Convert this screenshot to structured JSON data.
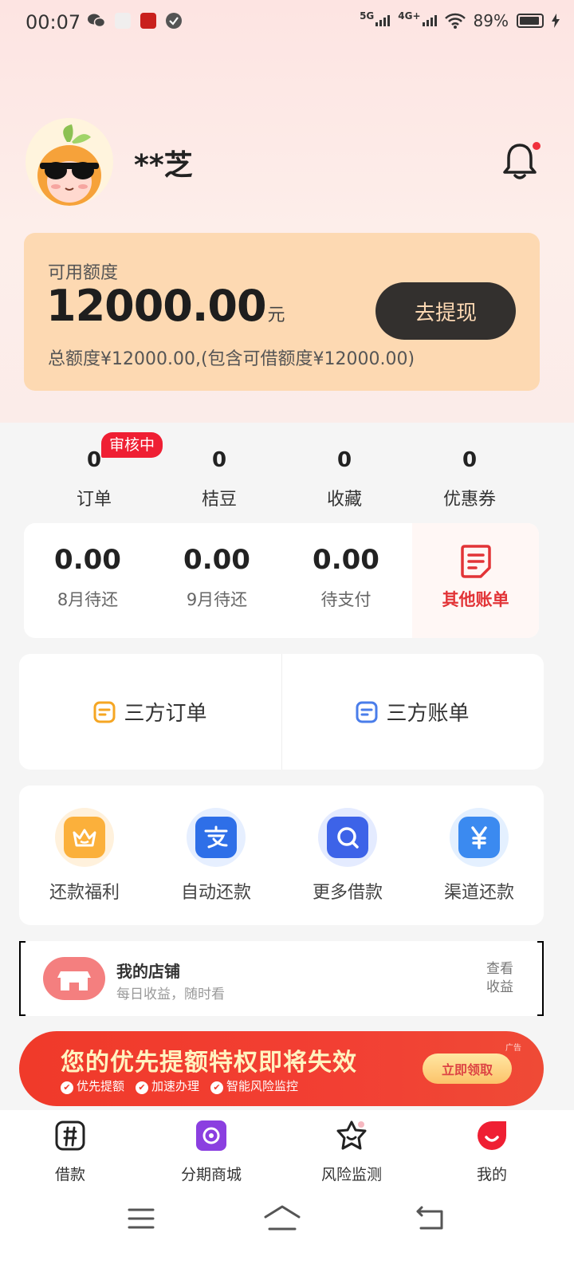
{
  "status": {
    "time": "00:07",
    "net1": "5G",
    "net2": "4G+",
    "battery": "89%"
  },
  "profile": {
    "username": "**芝"
  },
  "credit": {
    "label": "可用额度",
    "amount": "12000.00",
    "unit": "元",
    "total": "总额度¥12000.00,(包含可借额度¥12000.00)",
    "button": "去提现"
  },
  "stats": [
    {
      "value": "0",
      "label": "订单"
    },
    {
      "value": "0",
      "label": "桔豆"
    },
    {
      "value": "0",
      "label": "收藏"
    },
    {
      "value": "0",
      "label": "优惠券"
    }
  ],
  "stats_badge": "审核中",
  "bills": [
    {
      "value": "0.00",
      "label": "8月待还"
    },
    {
      "value": "0.00",
      "label": "9月待还"
    },
    {
      "value": "0.00",
      "label": "待支付"
    }
  ],
  "other_bill": "其他账单",
  "third_party": {
    "orders": "三方订单",
    "bills": "三方账单"
  },
  "services": [
    {
      "label": "还款福利",
      "icon": "crown-icon"
    },
    {
      "label": "自动还款",
      "icon": "alipay-icon"
    },
    {
      "label": "更多借款",
      "icon": "search-icon"
    },
    {
      "label": "渠道还款",
      "icon": "yen-icon"
    }
  ],
  "shop": {
    "title": "我的店铺",
    "subtitle": "每日收益，随时看",
    "link_line1": "查看",
    "link_line2": "收益"
  },
  "banner": {
    "title": "您的优先提额特权即将失效",
    "points": [
      "优先提额",
      "加速办理",
      "智能风险监控"
    ],
    "button": "立即领取",
    "ad": "广告"
  },
  "tabs": [
    {
      "label": "借款",
      "icon": "loan-icon"
    },
    {
      "label": "分期商城",
      "icon": "mall-icon"
    },
    {
      "label": "风险监测",
      "icon": "risk-icon"
    },
    {
      "label": "我的",
      "icon": "profile-icon"
    }
  ],
  "colors": {
    "accent_red": "#ef1f33",
    "card_peach": "#fdd9b2",
    "button_dark": "#33302e"
  }
}
